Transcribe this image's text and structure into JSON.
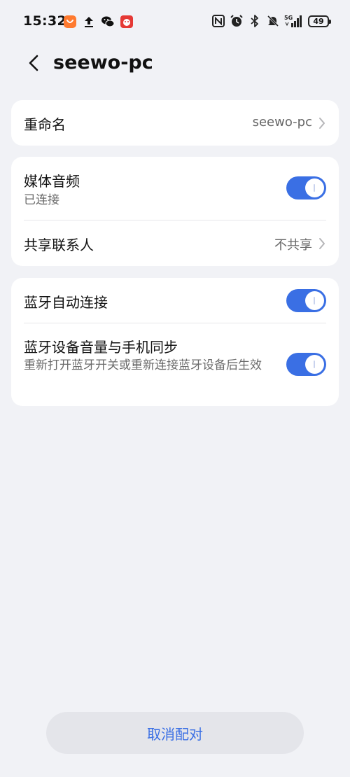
{
  "status_bar": {
    "time": "15:32",
    "battery": "49",
    "network": "5G",
    "left_icons": [
      "shopping-app-icon",
      "upload-icon",
      "wechat-icon",
      "game-app-icon"
    ],
    "right_icons": [
      "nfc-icon",
      "alarm-icon",
      "bluetooth-icon",
      "mute-icon",
      "signal-icon",
      "battery-icon"
    ]
  },
  "header": {
    "title": "seewo-pc",
    "back_icon": "chevron-left-icon"
  },
  "rename": {
    "label": "重命名",
    "value": "seewo-pc"
  },
  "media_audio": {
    "label": "媒体音频",
    "status": "已连接",
    "enabled": true
  },
  "share_contacts": {
    "label": "共享联系人",
    "value": "不共享"
  },
  "auto_connect": {
    "label": "蓝牙自动连接",
    "enabled": true
  },
  "volume_sync": {
    "label": "蓝牙设备音量与手机同步",
    "description": "重新打开蓝牙开关或重新连接蓝牙设备后生效",
    "enabled": true
  },
  "unpair": {
    "label": "取消配对"
  },
  "colors": {
    "accent": "#3a6fe4",
    "background": "#f1f2f6",
    "card": "#ffffff",
    "button_bg": "#e4e5ea"
  }
}
